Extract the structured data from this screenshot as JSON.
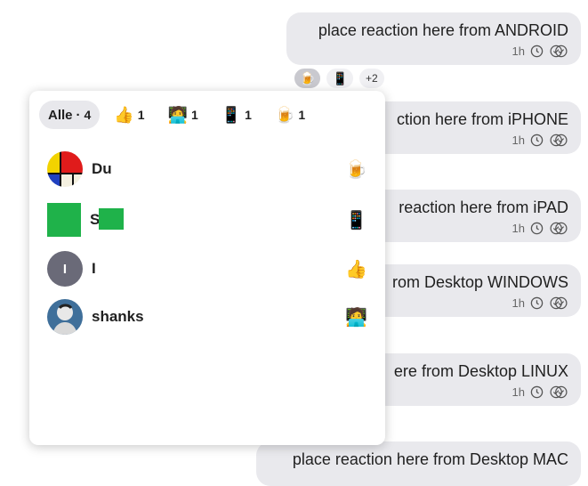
{
  "messages": [
    {
      "text": "place reaction here from ANDROID",
      "time": "1h"
    },
    {
      "text": "ction here from iPHONE",
      "time": "1h"
    },
    {
      "text": "reaction here from iPAD",
      "time": "1h"
    },
    {
      "text": "rom Desktop WINDOWS",
      "time": "1h"
    },
    {
      "text": "ere from Desktop LINUX",
      "time": "1h"
    },
    {
      "text": "place reaction here from Desktop MAC"
    }
  ],
  "message_reactions": {
    "beer": "🍺",
    "phone": "📱",
    "more": "+2"
  },
  "popover": {
    "tabs": [
      {
        "label": "Alle",
        "count": "4"
      },
      {
        "emoji": "👍",
        "count": "1"
      },
      {
        "emoji": "🧑‍💻",
        "count": "1"
      },
      {
        "emoji": "📱",
        "count": "1"
      },
      {
        "emoji": "🍺",
        "count": "1"
      }
    ],
    "users": [
      {
        "name": "Du",
        "reaction": "🍺"
      },
      {
        "name": "S",
        "reaction": "📱"
      },
      {
        "name": "I",
        "initial": "I",
        "reaction": "👍"
      },
      {
        "name": "shanks",
        "reaction": "🧑‍💻"
      }
    ]
  }
}
